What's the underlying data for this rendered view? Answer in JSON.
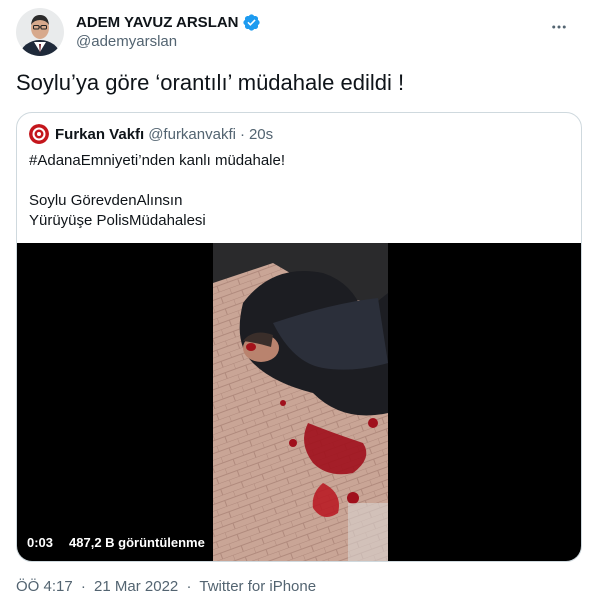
{
  "author": {
    "display_name": "ADEM YAVUZ ARSLAN",
    "handle": "@ademyarslan",
    "verified": true,
    "avatar_icon": "person-avatar-icon"
  },
  "tweet": {
    "text": "Soylu’ya göre ‘orantılı’ müdahale edildi !"
  },
  "quote": {
    "display_name": "Furkan Vakfı",
    "handle": "@furkanvakfi",
    "separator": "·",
    "time": "20s",
    "lines": [
      "#AdanaEmniyeti’nden kanlı müdahale!",
      "Soylu GörevdenAlınsın",
      "Yürüyüşe PolisMüdahalesi"
    ],
    "video": {
      "duration": "0:03",
      "views": "487,2 B görüntülenme"
    }
  },
  "meta": {
    "time": "ÖÖ 4:17",
    "separator1": "·",
    "date": "21 Mar 2022",
    "separator2": "·",
    "source": "Twitter for iPhone"
  },
  "colors": {
    "text": "#0f1419",
    "secondary": "#536471",
    "verified_blue": "#1d9bf0",
    "border": "#cfd9de",
    "video_bg": "#000000"
  }
}
